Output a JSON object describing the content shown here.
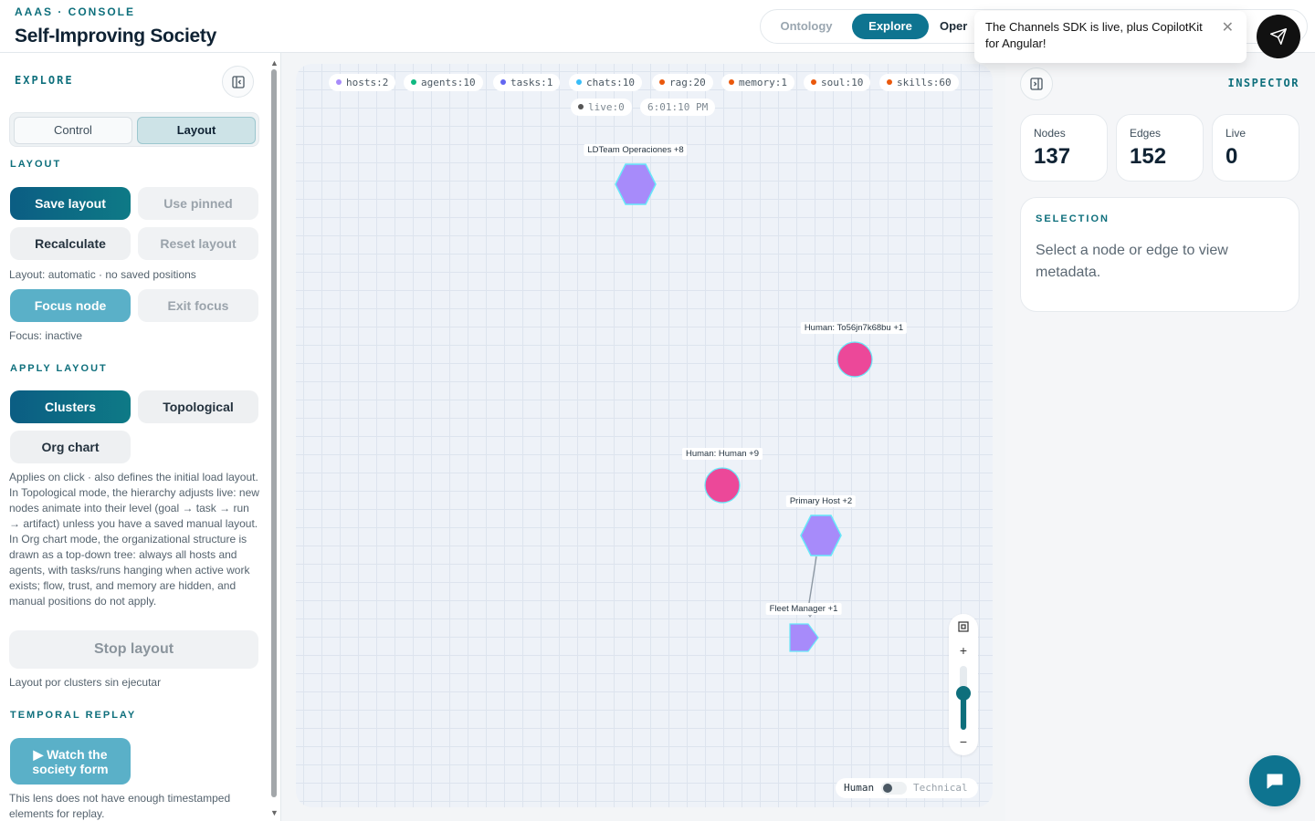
{
  "header": {
    "eyebrow": "AAAS · CONSOLE",
    "title": "Self-Improving Society",
    "tabs": [
      "Ontology",
      "Explore",
      "Oper"
    ],
    "active_tab": "Explore"
  },
  "toast": {
    "message": "The Channels SDK is live, plus CopilotKit for Angular!",
    "close_icon": "close-icon"
  },
  "left_panel": {
    "title": "EXPLORE",
    "segments": [
      "Control",
      "Layout"
    ],
    "active_segment": "Layout",
    "layout_section": {
      "heading": "LAYOUT",
      "save_layout": "Save layout",
      "use_pinned": "Use pinned",
      "recalculate": "Recalculate",
      "reset_layout": "Reset layout",
      "layout_status": "Layout: automatic · no saved positions",
      "focus_node": "Focus node",
      "exit_focus": "Exit focus",
      "focus_status": "Focus: inactive"
    },
    "apply_section": {
      "heading": "APPLY LAYOUT",
      "clusters": "Clusters",
      "topological": "Topological",
      "org_chart": "Org chart",
      "description": "Applies on click · also defines the initial load layout. In Topological mode, the hierarchy adjusts live: new nodes animate into their level (goal → task → run → artifact) unless you have a saved manual layout. In Org chart mode, the organizational structure is drawn as a top-down tree: always all hosts and agents, with tasks/runs hanging when active work exists; flow, trust, and memory are hidden, and manual positions do not apply.",
      "stop_layout": "Stop layout",
      "stop_status": "Layout por clusters sin ejecutar"
    },
    "temporal_section": {
      "heading": "TEMPORAL REPLAY",
      "watch_button": "▶ Watch the society form",
      "note": "This lens does not have enough timestamped elements for replay."
    }
  },
  "graph": {
    "chips": [
      {
        "text": "hosts:2",
        "color": "#a78bfa"
      },
      {
        "text": "agents:10",
        "color": "#10b981"
      },
      {
        "text": "tasks:1",
        "color": "#6366f1"
      },
      {
        "text": "chats:10",
        "color": "#38bdf8"
      },
      {
        "text": "rag:20",
        "color": "#ea580c"
      },
      {
        "text": "memory:1",
        "color": "#ea580c"
      },
      {
        "text": "soul:10",
        "color": "#ea580c"
      },
      {
        "text": "skills:60",
        "color": "#ea580c"
      }
    ],
    "live_chip": {
      "text": "live:0",
      "color": "#555555"
    },
    "clock": "6:01:10 PM",
    "nodes": [
      {
        "label": "LDTeam Operaciones +8",
        "shape": "hexagon",
        "color": "#a78bfa"
      },
      {
        "label": "Human: To56jn7k68bu +1",
        "shape": "circle",
        "color": "#ec4899"
      },
      {
        "label": "Human: Human +9",
        "shape": "circle",
        "color": "#ec4899"
      },
      {
        "label": "Primary Host +2",
        "shape": "hexagon",
        "color": "#a78bfa"
      },
      {
        "label": "Fleet Manager +1",
        "shape": "pentagon",
        "color": "#a78bfa"
      }
    ],
    "zoom": {
      "fit_icon": "fit-view-icon",
      "plus": "+",
      "minus": "−",
      "level": 0.57
    },
    "lens_toggle": {
      "left": "Human",
      "right": "Technical",
      "active": "Human"
    }
  },
  "inspector": {
    "title": "INSPECTOR",
    "stats": [
      {
        "label": "Nodes",
        "value": "137"
      },
      {
        "label": "Edges",
        "value": "152"
      },
      {
        "label": "Live",
        "value": "0"
      }
    ],
    "selection_heading": "SELECTION",
    "selection_text": "Select a node or edge to view metadata."
  },
  "colors": {
    "accent": "#0e7490",
    "brand_teal": "#0e6f7c",
    "human_node": "#ec4899",
    "host_node": "#a78bfa"
  }
}
